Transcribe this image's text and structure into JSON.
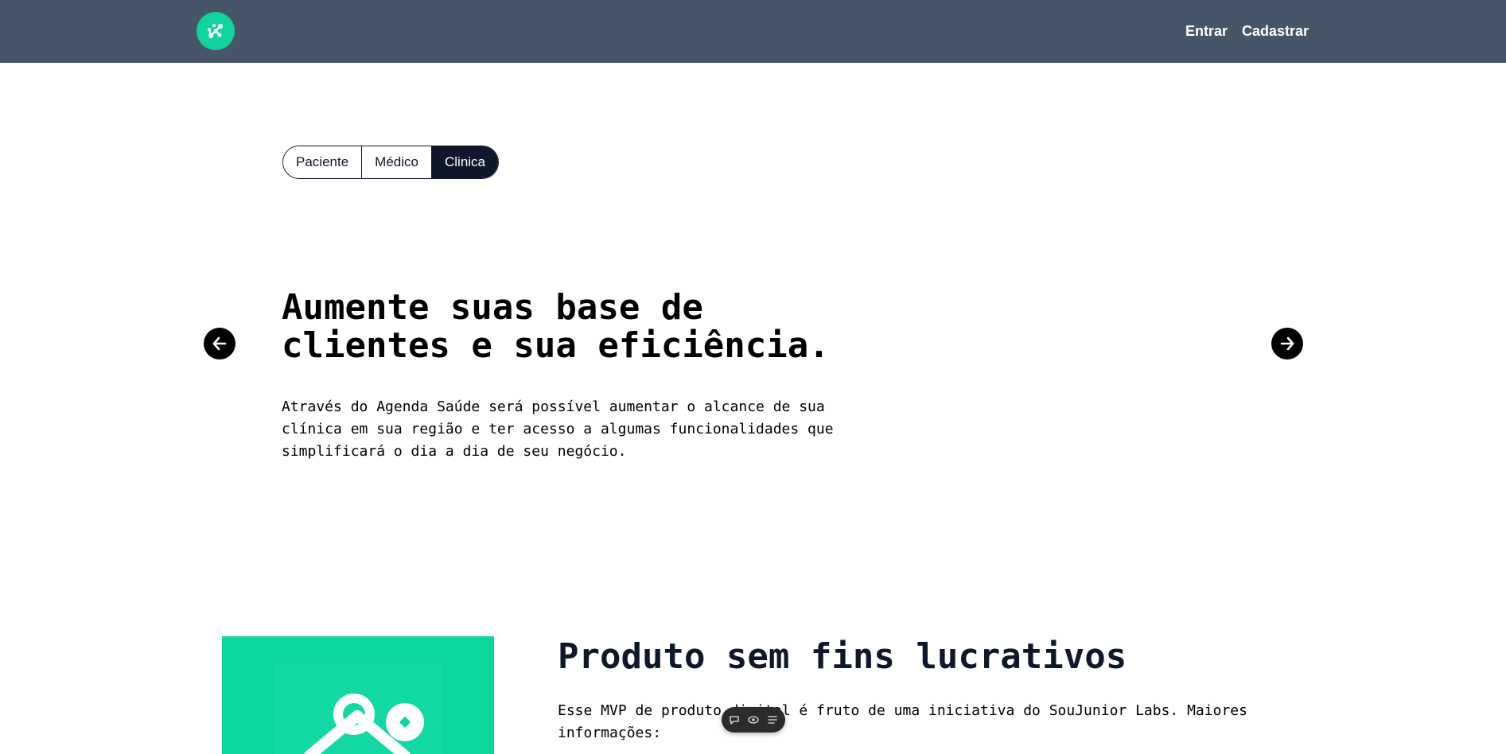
{
  "header": {
    "logo_color": "#10d3a0",
    "nav": {
      "login_label": "Entrar",
      "signup_label": "Cadastrar"
    },
    "background_color": "#475569"
  },
  "audience_toggle": {
    "options": [
      {
        "label": "Paciente",
        "active": false
      },
      {
        "label": "Médico",
        "active": false
      },
      {
        "label": "Clinica",
        "active": true
      }
    ]
  },
  "hero": {
    "title_line1": "Aumente suas base de",
    "title_line2": "clientes e sua eficiência.",
    "text_line1": "Através do Agenda Saúde será possível aumentar o alcance de sua",
    "text_line2": "clínica em sua região e ter acesso a algumas funcionalidades que",
    "text_line3": "simplificará o dia a dia de seu negócio."
  },
  "carousel": {
    "prev_icon": "arrow-left-icon",
    "next_icon": "arrow-right-icon"
  },
  "product": {
    "title": "Produto sem fins lucrativos",
    "text_line1": "Esse MVP de produto digital é fruto de uma iniciativa do SouJunior Labs. Maiores",
    "text_line2": "informações:",
    "image_color": "#0ad69e"
  },
  "floating_toolbar": {
    "icons": [
      "comment-icon",
      "eye-icon",
      "list-icon"
    ]
  }
}
